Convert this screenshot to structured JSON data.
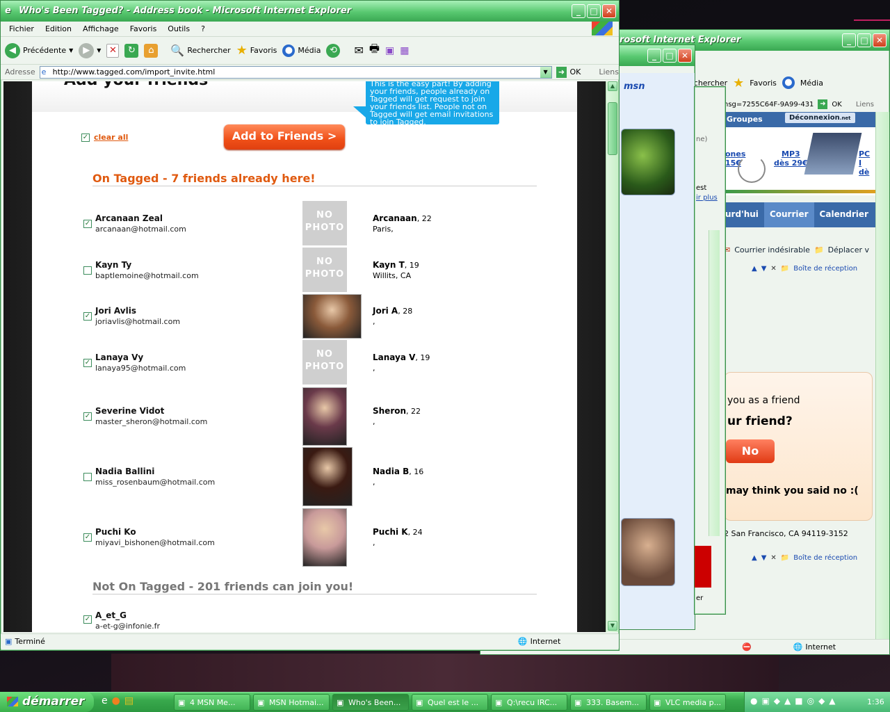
{
  "main_window": {
    "title": "Who's Been Tagged? - Address book - Microsoft Internet Explorer",
    "menu": [
      "Fichier",
      "Edition",
      "Affichage",
      "Favoris",
      "Outils",
      "?"
    ],
    "toolbar": {
      "back": "Précédente",
      "search": "Rechercher",
      "favorites": "Favoris",
      "media": "Média"
    },
    "address_label": "Adresse",
    "url": "http://www.tagged.com/import_invite.html",
    "go": "OK",
    "links": "Liens",
    "status_left": "Terminé",
    "status_zone": "Internet"
  },
  "page": {
    "heading_partial": "Add your friends",
    "tooltip": "This is the easy part! By adding your friends, people already on Tagged will get request to join your friends list. People not on Tagged will get email invitations to join Tagged.",
    "clear_all": "clear all",
    "add_button": "Add to Friends >",
    "on_tagged_heading": "On Tagged - 7 friends already here!",
    "not_on_tagged_heading": "Not On Tagged - 201 friends can join you!",
    "no_photo_text": "NO PHOTO",
    "friends": [
      {
        "name": "Arcanaan Zeal",
        "email": "arcanaan@hotmail.com",
        "tname": "Arcanaan",
        "age": ", 22",
        "loc": "Paris,",
        "checked": "✓",
        "photo": "none"
      },
      {
        "name": "Kayn Ty",
        "email": "baptlemoine@hotmail.com",
        "tname": "Kayn T",
        "age": ", 19",
        "loc": "Willits, CA",
        "checked": "",
        "photo": "none"
      },
      {
        "name": "Jori Avlis",
        "email": "joriavlis@hotmail.com",
        "tname": "Jori A",
        "age": ", 28",
        "loc": ",",
        "checked": "✓",
        "photo": "#8a5a3a"
      },
      {
        "name": "Lanaya Vy",
        "email": "lanaya95@hotmail.com",
        "tname": "Lanaya V",
        "age": ", 19",
        "loc": ",",
        "checked": "✓",
        "photo": "none"
      },
      {
        "name": "Severine Vidot",
        "email": "master_sheron@hotmail.com",
        "tname": "Sheron",
        "age": ", 22",
        "loc": ",",
        "checked": "✓",
        "photo": "#6a3a4a"
      },
      {
        "name": "Nadia Ballini",
        "email": "miss_rosenbaum@hotmail.com",
        "tname": "Nadia B",
        "age": ", 16",
        "loc": ",",
        "checked": "",
        "photo": "#3a1a12"
      },
      {
        "name": "Puchi Ko",
        "email": "miyavi_bishonen@hotmail.com",
        "tname": "Puchi K",
        "age": ", 24",
        "loc": ",",
        "checked": "✓",
        "photo": "#c89a9a"
      }
    ],
    "not_on_first": {
      "name": "A_et_G",
      "email": "a-et-g@infonie.fr",
      "checked": "✓"
    }
  },
  "back_window": {
    "title": "rosoft Internet Explorer",
    "toolbar": {
      "search": "echercher",
      "favorites": "Favoris",
      "media": "Média"
    },
    "url_fragment": "nsg=7255C64F-9A99-431",
    "go": "OK",
    "links": "Liens",
    "groups": "Groupes",
    "logout": "Déconnexion",
    "logout_suffix": ".net",
    "ad_phones": "ones",
    "ad_price1": "15€",
    "ad_mp3": "MP3",
    "ad_mp3_price": "dès 29€",
    "ad_pc": "PC I",
    "ad_pc_price": "dè",
    "tabs": [
      "urd'hui",
      "Courrier",
      "Calendrier"
    ],
    "junk": "Courrier indésirable",
    "move": "Déplacer v",
    "inbox": "Boîte de réception",
    "friend_text1": "you as a friend",
    "friend_text2": "ur friend?",
    "no_button": "No",
    "friend_text3": "may think you said no :(",
    "address_text": "2 San Francisco, CA 94119-3152",
    "status_zone": "Internet"
  },
  "msn_window": {
    "brand": "msn",
    "side_text1": "est",
    "side_text2": "ir plus",
    "side_text3": "ne)",
    "side_text4": "er"
  },
  "taskbar": {
    "start": "démarrer",
    "tasks": [
      "4 MSN Me...",
      "MSN Hotmai...",
      "Who's Been...",
      "Quel est le ...",
      "Q:\\recu IRC...",
      "333. Basem...",
      "VLC media p..."
    ],
    "clock": "1:36"
  }
}
